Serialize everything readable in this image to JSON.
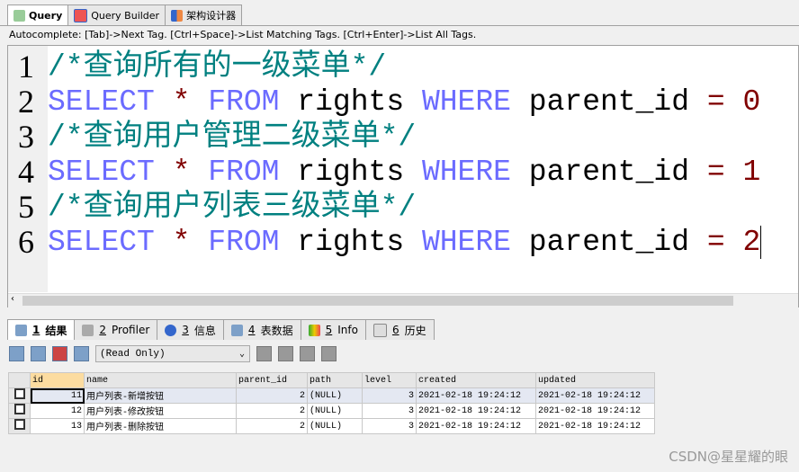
{
  "query_tabs": [
    {
      "label": "Query",
      "icon": "query-icon"
    },
    {
      "label": "Query Builder",
      "icon": "query-builder-icon"
    },
    {
      "label": "架构设计器",
      "icon": "schema-designer-icon"
    }
  ],
  "autocomplete": "Autocomplete: [Tab]->Next Tag. [Ctrl+Space]->List Matching Tags. [Ctrl+Enter]->List All Tags.",
  "editor": {
    "lines": [
      {
        "n": "1",
        "comment": "/*查询所有的一级菜单*/"
      },
      {
        "n": "2",
        "kw1": "SELECT",
        "star": "*",
        "kw2": "FROM",
        "table": "rights",
        "kw3": "WHERE",
        "col": "parent_id",
        "eq": "=",
        "val": "0"
      },
      {
        "n": "3",
        "comment": "/*查询用户管理二级菜单*/"
      },
      {
        "n": "4",
        "kw1": "SELECT",
        "star": "*",
        "kw2": "FROM",
        "table": "rights",
        "kw3": "WHERE",
        "col": "parent_id",
        "eq": "=",
        "val": "1"
      },
      {
        "n": "5",
        "comment": "/*查询用户列表三级菜单*/"
      },
      {
        "n": "6",
        "kw1": "SELECT",
        "star": "*",
        "kw2": "FROM",
        "table": "rights",
        "kw3": "WHERE",
        "col": "parent_id",
        "eq": "=",
        "val": "2"
      }
    ]
  },
  "result_tabs": [
    {
      "num": "1",
      "label": "结果"
    },
    {
      "num": "2",
      "label": "Profiler"
    },
    {
      "num": "3",
      "label": "信息"
    },
    {
      "num": "4",
      "label": "表数据"
    },
    {
      "num": "5",
      "label": "Info"
    },
    {
      "num": "6",
      "label": "历史"
    }
  ],
  "toolbar": {
    "mode": "(Read Only)"
  },
  "grid": {
    "columns": [
      "id",
      "name",
      "parent_id",
      "path",
      "level",
      "created",
      "updated"
    ],
    "rows": [
      [
        "11",
        "用户列表-新增按钮",
        "2",
        "(NULL)",
        "3",
        "2021-02-18 19:24:12",
        "2021-02-18 19:24:12"
      ],
      [
        "12",
        "用户列表-修改按钮",
        "2",
        "(NULL)",
        "3",
        "2021-02-18 19:24:12",
        "2021-02-18 19:24:12"
      ],
      [
        "13",
        "用户列表-删除按钮",
        "2",
        "(NULL)",
        "3",
        "2021-02-18 19:24:12",
        "2021-02-18 19:24:12"
      ]
    ]
  },
  "watermark": "CSDN@星星耀的眼"
}
